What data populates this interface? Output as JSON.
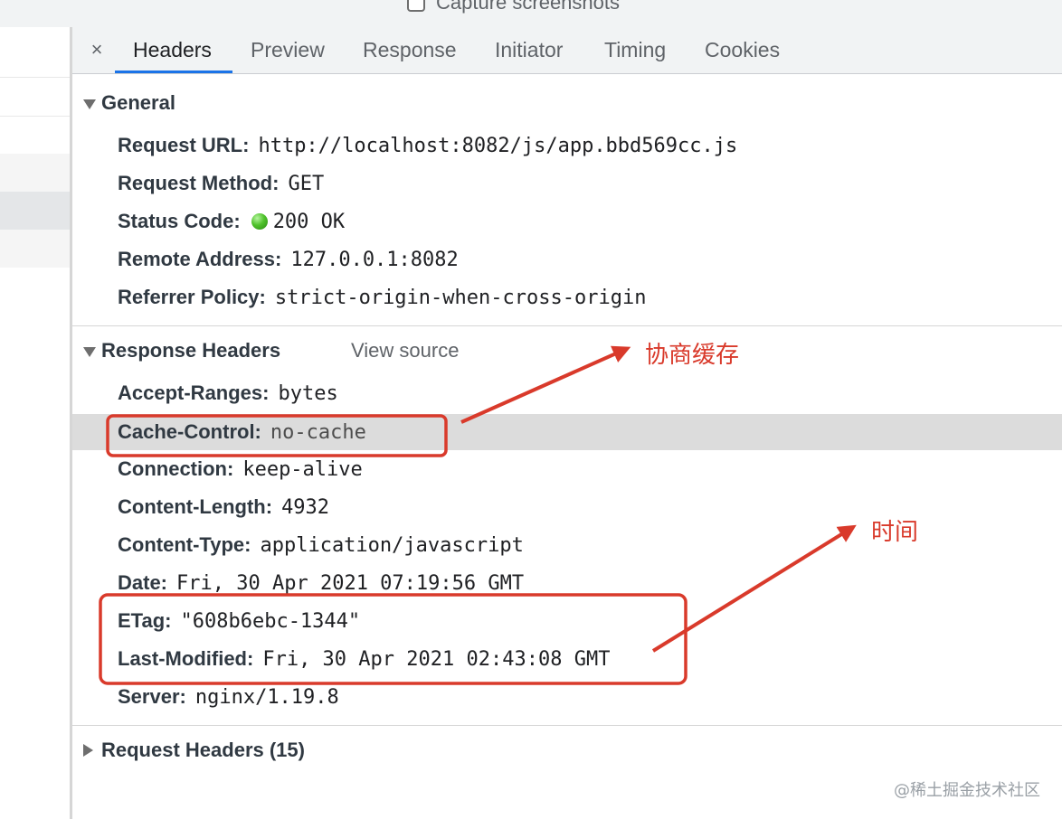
{
  "top": {
    "capture_label": "Capture screenshots",
    "capture_checked": false
  },
  "tabs": {
    "close": "×",
    "items": [
      {
        "label": "Headers",
        "active": true
      },
      {
        "label": "Preview",
        "active": false
      },
      {
        "label": "Response",
        "active": false
      },
      {
        "label": "Initiator",
        "active": false
      },
      {
        "label": "Timing",
        "active": false
      },
      {
        "label": "Cookies",
        "active": false
      }
    ]
  },
  "general": {
    "title": "General",
    "rows": [
      {
        "key": "Request URL:",
        "value": "http://localhost:8082/js/app.bbd569cc.js"
      },
      {
        "key": "Request Method:",
        "value": "GET"
      },
      {
        "key": "Status Code:",
        "value": "200 OK",
        "status_color": "#4fc22b"
      },
      {
        "key": "Remote Address:",
        "value": "127.0.0.1:8082"
      },
      {
        "key": "Referrer Policy:",
        "value": "strict-origin-when-cross-origin"
      }
    ]
  },
  "response_headers": {
    "title": "Response Headers",
    "view_source": "View source",
    "rows": [
      {
        "key": "Accept-Ranges:",
        "value": "bytes"
      },
      {
        "key": "Cache-Control:",
        "value": "no-cache"
      },
      {
        "key": "Connection:",
        "value": "keep-alive"
      },
      {
        "key": "Content-Length:",
        "value": "4932"
      },
      {
        "key": "Content-Type:",
        "value": "application/javascript"
      },
      {
        "key": "Date:",
        "value": "Fri, 30 Apr 2021 07:19:56 GMT"
      },
      {
        "key": "ETag:",
        "value": "\"608b6ebc-1344\""
      },
      {
        "key": "Last-Modified:",
        "value": "Fri, 30 Apr 2021 02:43:08 GMT"
      },
      {
        "key": "Server:",
        "value": "nginx/1.19.8"
      }
    ]
  },
  "request_headers": {
    "title": "Request Headers (15)"
  },
  "annotations": {
    "note_cache": "协商缓存",
    "note_time": "时间",
    "color": "#d93a2b"
  },
  "watermark": "@稀土掘金技术社区"
}
